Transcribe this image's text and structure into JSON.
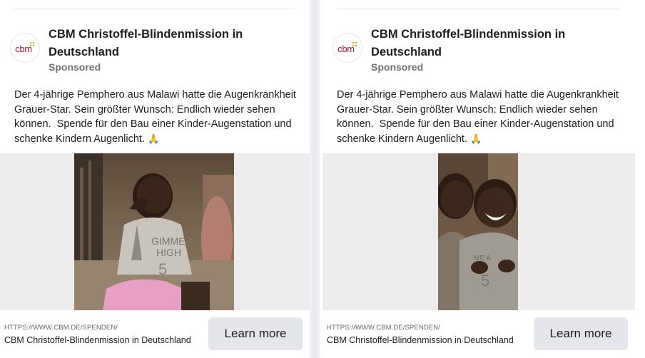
{
  "ads": [
    {
      "advertiser": "CBM Christoffel-Blindenmission in Deutschland",
      "avatar_text": "cbm",
      "sponsored": "Sponsored",
      "text": "Der 4-jährige Pemphero aus Malawi hatte die Augenkrankheit Grauer-Star. Sein größter Wunsch: Endlich wieder sehen können.  Spende für den Bau einer Kinder-Augenstation und schenke Kindern Augenlicht.",
      "emoji": "🙏",
      "image_icon": "child-rubbing-eye-photo",
      "link_url": "HTTPS://WWW.CBM.DE/SPENDEN/",
      "link_title": "CBM Christoffel-Blindenmission in Deutschland",
      "cta_label": "Learn more"
    },
    {
      "advertiser": "CBM Christoffel-Blindenmission in Deutschland",
      "avatar_text": "cbm",
      "sponsored": "Sponsored",
      "text": "Der 4-jährige Pemphero aus Malawi hatte die Augenkrankheit Grauer-Star. Sein größter Wunsch: Endlich wieder sehen können.  Spende für den Bau einer Kinder-Augenstation und schenke Kindern Augenlicht.",
      "emoji": "🙏",
      "image_icon": "smiling-children-photo",
      "link_url": "HTTPS://WWW.CBM.DE/SPENDEN/",
      "link_title": "CBM Christoffel-Blindenmission in Deutschland",
      "cta_label": "Learn more"
    }
  ],
  "colors": {
    "brand_red": "#b3122f",
    "brand_yellow": "#e8a200",
    "cta_background": "#e4e6eb",
    "media_background": "#ececed",
    "secondary_text": "#65676b"
  }
}
